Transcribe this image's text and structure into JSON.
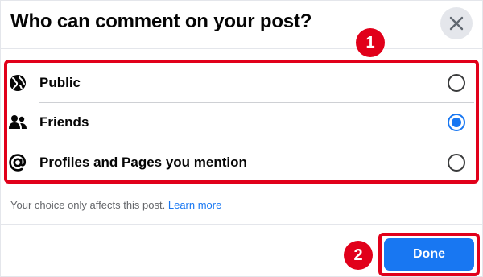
{
  "dialog": {
    "title": "Who can comment on your post?",
    "close_icon": "close-icon"
  },
  "options": [
    {
      "label": "Public",
      "icon": "globe-icon",
      "selected": false
    },
    {
      "label": "Friends",
      "icon": "friends-icon",
      "selected": true
    },
    {
      "label": "Profiles and Pages you mention",
      "icon": "at-sign-icon",
      "selected": false
    }
  ],
  "hint": {
    "text": "Your choice only affects this post.",
    "link": "Learn more"
  },
  "actions": {
    "done_label": "Done"
  },
  "annotations": {
    "badge_1": "1",
    "badge_2": "2"
  },
  "colors": {
    "accent": "#1877f2",
    "highlight": "#e1001a",
    "text": "#050505",
    "muted": "#65676b"
  }
}
